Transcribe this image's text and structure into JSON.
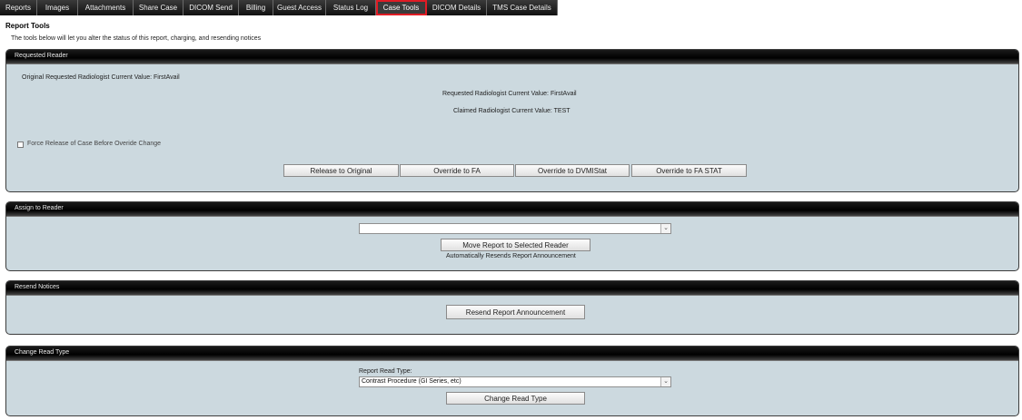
{
  "tabs": [
    {
      "label": "Reports",
      "width": 41
    },
    {
      "label": "Images",
      "width": 45
    },
    {
      "label": "Attachments",
      "width": 61
    },
    {
      "label": "Share Case",
      "width": 55
    },
    {
      "label": "DICOM Send",
      "width": 61
    },
    {
      "label": "Billing",
      "width": 38
    },
    {
      "label": "Guest Access",
      "width": 58
    },
    {
      "label": "Status Log",
      "width": 55
    },
    {
      "label": "Case Tools",
      "width": 56,
      "active": true
    },
    {
      "label": "DICOM Details",
      "width": 66
    },
    {
      "label": "TMS Case Details",
      "width": 78
    }
  ],
  "page": {
    "title": "Report Tools",
    "description": "The tools below will let you alter the status of this report, charging, and resending notices"
  },
  "requested_reader": {
    "header": "Requested Reader",
    "original_value": "Original Requested Radiologist Current Value: FirstAvail",
    "requested_value": "Requested Radiologist Current Value: FirstAvail",
    "claimed_value": "Claimed Radiologist Current Value: TEST",
    "force_release_label": "Force Release of Case Before Overide Change",
    "buttons": {
      "release": "Release to Original",
      "override_fa": "Override to FA",
      "override_dvmistat": "Override to DVMIStat",
      "override_fa_stat": "Override to FA STAT"
    }
  },
  "assign_reader": {
    "header": "Assign to Reader",
    "select_value": "",
    "move_button": "Move Report to Selected Reader",
    "note": "Automatically Resends Report Announcement"
  },
  "resend_notices": {
    "header": "Resend Notices",
    "button": "Resend Report Announcement"
  },
  "change_read_type": {
    "header": "Change Read Type",
    "label": "Report Read Type:",
    "select_value": "Contrast Procedure (GI Series, etc)",
    "button": "Change Read Type"
  },
  "icons": {
    "dropdown": "chevron-down-icon"
  },
  "colors": {
    "panel_bg": "#ccd9df",
    "header_bg": "#000000",
    "active_tab_outline": "#e01b24"
  }
}
